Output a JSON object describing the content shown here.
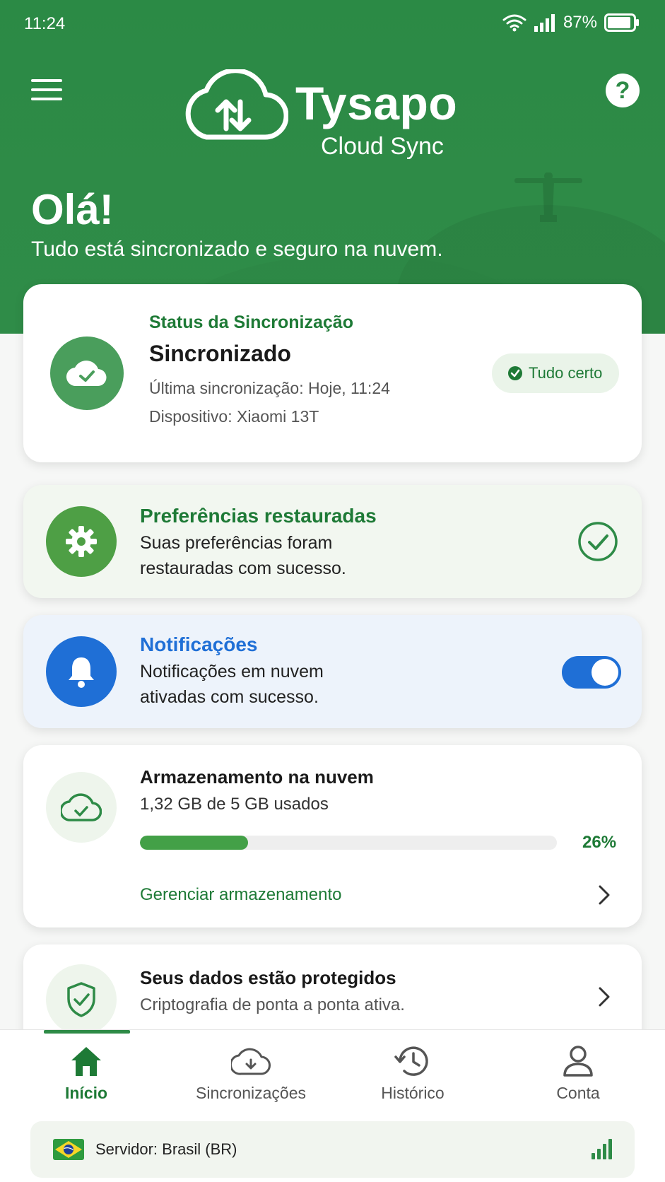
{
  "status_bar": {
    "time": "11:24",
    "battery": "87%"
  },
  "header": {
    "brand": "Tysapo",
    "brand_sub": "Cloud Sync",
    "greeting": "Olá!",
    "tagline": "Tudo está sincronizado e seguro na nuvem."
  },
  "sync_card": {
    "heading": "Status da Sincronização",
    "status": "Sincronizado",
    "last_sync": "Última sincronização: Hoje, 11:24",
    "device": "Dispositivo: Xiaomi 13T",
    "badge": "Tudo certo"
  },
  "pref_card": {
    "title": "Preferências restauradas",
    "line1": "Suas preferências foram",
    "line2": "restauradas com sucesso."
  },
  "notif_card": {
    "title": "Notificações",
    "line1": "Notificações em nuvem",
    "line2": "ativadas com sucesso.",
    "toggle_on": true
  },
  "storage_card": {
    "title": "Armazenamento na nuvem",
    "usage": "1,32 GB de 5 GB usados",
    "percent_label": "26%",
    "percent_value": 0.26,
    "manage_link": "Gerenciar armazenamento"
  },
  "protect_card": {
    "title": "Seus dados estão protegidos",
    "subtitle": "Criptografia de ponta a ponta ativa."
  },
  "nav": {
    "items": [
      {
        "label": "Início",
        "icon": "home-icon"
      },
      {
        "label": "Sincronizações",
        "icon": "cloud-sync-icon"
      },
      {
        "label": "Histórico",
        "icon": "history-icon"
      },
      {
        "label": "Conta",
        "icon": "person-icon"
      }
    ]
  },
  "server": {
    "label": "Servidor: Brasil (BR)",
    "flag": "brazil-flag-icon"
  },
  "colors": {
    "brand_green": "#2e8b47",
    "accent_blue": "#1f6fd6",
    "progress_green": "#43a047"
  }
}
